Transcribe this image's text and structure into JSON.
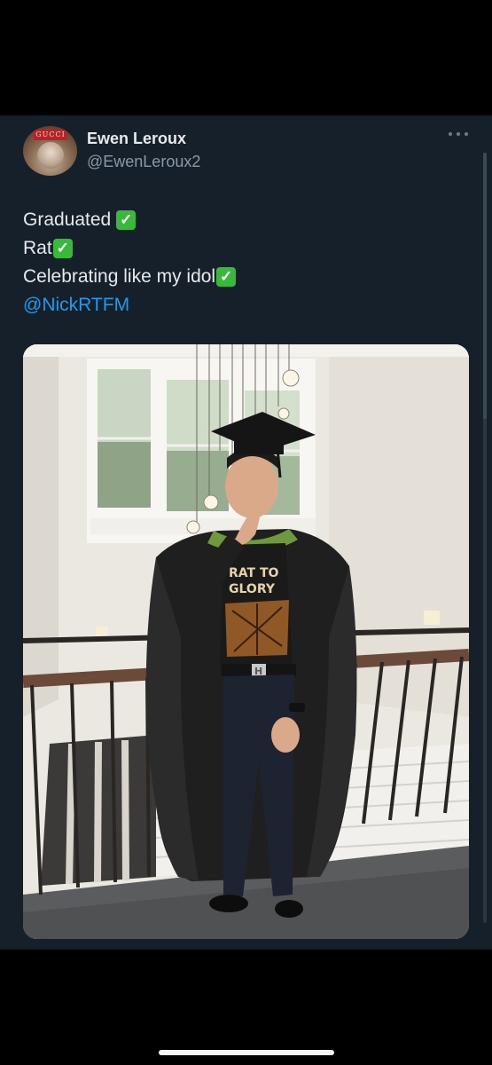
{
  "tweet": {
    "cut_char": "·",
    "author": {
      "display_name": "Ewen Leroux",
      "handle": "@EwenLeroux2",
      "avatar_brand_text": "GUCCI"
    },
    "text_lines": [
      {
        "text": "Graduated",
        "check": "✓"
      },
      {
        "text": "Rat",
        "check": "✓"
      },
      {
        "text": "Celebrating like my idol",
        "check": "✓"
      }
    ],
    "mention": "@NickRTFM",
    "photo": {
      "shirt_text_line1": "RAT TO",
      "shirt_text_line2": "GLORY",
      "belt_buckle": "H"
    }
  },
  "colors": {
    "background": "#15202b",
    "text": "#e7e9ea",
    "secondary_text": "#8b98a5",
    "mention": "#1d9bf0",
    "check": "#38b93b"
  },
  "icons": {
    "more": "more-horizontal-icon",
    "check": "check-mark-button-icon"
  }
}
